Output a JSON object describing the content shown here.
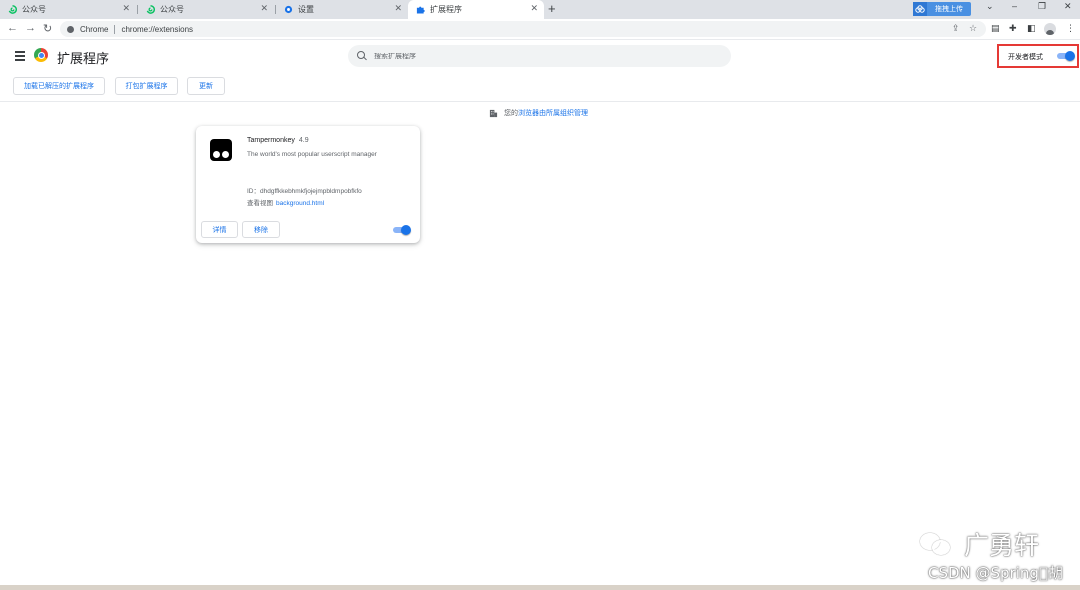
{
  "browser": {
    "tabs": [
      {
        "title": "公众号",
        "icon": "wechat-public-icon",
        "active": false
      },
      {
        "title": "公众号",
        "icon": "wechat-public-icon",
        "active": false
      },
      {
        "title": "设置",
        "icon": "settings-gear-icon",
        "active": false
      },
      {
        "title": "扩展程序",
        "icon": "puzzle-icon",
        "active": true
      }
    ],
    "new_tab": "+",
    "upload_label": "拖拽上传",
    "omnibox": {
      "site_label": "Chrome",
      "url": "chrome://extensions"
    }
  },
  "header": {
    "title": "扩展程序",
    "search_placeholder": "搜索扩展程序",
    "dev_mode_label": "开发者模式",
    "dev_mode_on": true
  },
  "dev_buttons": {
    "load_unpacked": "加载已解压的扩展程序",
    "pack": "打包扩展程序",
    "update": "更新"
  },
  "managed": {
    "prefix": "您的",
    "link": "浏览器由所属组织管理"
  },
  "extension": {
    "name": "Tampermonkey",
    "version": "4.9",
    "description": "The world's most popular userscript manager",
    "id_label": "ID：",
    "id": "dhdgffkkebhmkfjojejmpbldmpobfkfo",
    "views_label": "查看视图",
    "views_link": "background.html",
    "details_btn": "详情",
    "remove_btn": "移除",
    "enabled": true
  },
  "watermark": {
    "line1": "广勇轩",
    "line2": "CSDN @Spring\u0000胡"
  },
  "colors": {
    "accent": "#1a73e8",
    "highlight_border": "#e53935"
  }
}
